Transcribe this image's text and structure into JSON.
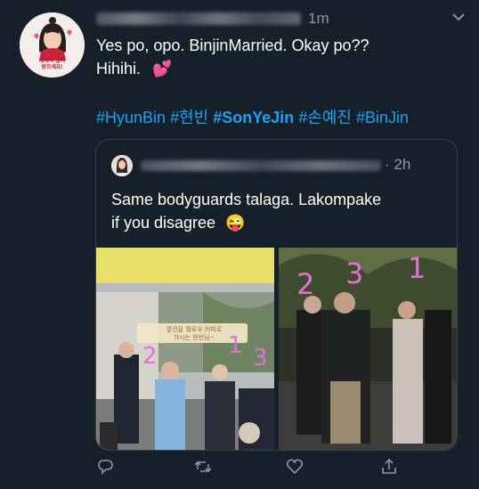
{
  "tweet": {
    "time": "1m",
    "text_line1": "Yes po, opo. BinjinMarried. Okay po??",
    "text_line2": "Hihihi.",
    "emoji": "💕",
    "hashtags": [
      {
        "text": "#HyunBin",
        "bold": false
      },
      {
        "text": "#현빈",
        "bold": false
      },
      {
        "text": "#SonYeJin",
        "bold": true
      },
      {
        "text": "#손예진",
        "bold": false
      },
      {
        "text": "#BinJin",
        "bold": false
      }
    ],
    "avatar_caption_1": "새해복 많이",
    "avatar_caption_2": "받으세요!"
  },
  "quote": {
    "time": "2h",
    "text_line1": "Same bodyguards talaga. Lakompake",
    "text_line2": "if you disagree",
    "emoji": "😜",
    "photo1_sign_1": "열건을 뭘로우 커피로",
    "photo1_sign_2": "가시는 현빈님~",
    "photo1_numbers": [
      "2",
      "1",
      "3"
    ],
    "photo2_numbers": [
      "2",
      "3",
      "1"
    ]
  },
  "colors": {
    "background": "#15202b",
    "link": "#1da1f2",
    "muted": "#8899a6",
    "border": "#38444d",
    "annotation": "#e36fd8"
  },
  "icons": [
    "reply-icon",
    "retweet-icon",
    "like-icon",
    "share-icon",
    "more-chevron-icon"
  ]
}
